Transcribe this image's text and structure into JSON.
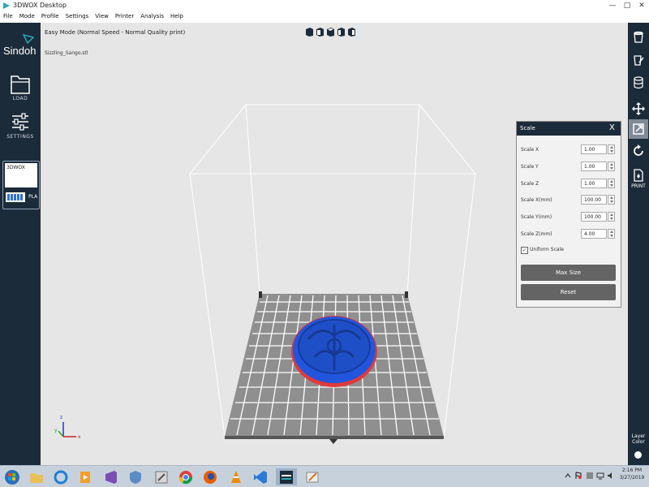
{
  "window": {
    "title": "3DWOX Desktop",
    "minimize": "—",
    "maximize": "□",
    "close": "✕"
  },
  "menu": [
    "File",
    "Mode",
    "Profile",
    "Settings",
    "View",
    "Printer",
    "Analysis",
    "Help"
  ],
  "brand": {
    "logo_text": "Sindoh",
    "accent": "#2aa7b8"
  },
  "sidebar": {
    "load_label": "LOAD",
    "settings_label": "SETTINGS",
    "material": {
      "name": "3DWOX",
      "type": "PLA",
      "bar_color": "#2f72d6"
    }
  },
  "viewport": {
    "mode_text": "Easy Mode (Normal Speed - Normal Quality print)",
    "file_name": "Sizzling_Sango.stl",
    "model_color": "#2255dd",
    "model_outline": "#e03a3a",
    "axes": {
      "z": "z",
      "y": "y",
      "x": "x"
    }
  },
  "scale_panel": {
    "title": "Scale",
    "close": "X",
    "rows": [
      {
        "label": "Scale X",
        "value": "1.00"
      },
      {
        "label": "Scale Y",
        "value": "1.00"
      },
      {
        "label": "Scale Z",
        "value": "1.00"
      },
      {
        "label": "Scale X(mm)",
        "value": "100.00"
      },
      {
        "label": "Scale Y(mm)",
        "value": "100.00"
      },
      {
        "label": "Scale Z(mm)",
        "value": "4.00"
      }
    ],
    "uniform_checked": "✓",
    "uniform_label": "Uniform Scale",
    "max_size_label": "Max Size",
    "reset_label": "Reset"
  },
  "rightbar": {
    "print_label": "PRINT",
    "layer_color_label_1": "Layer",
    "layer_color_label_2": "Color"
  },
  "taskbar": {
    "time": "2:16 PM",
    "date": "3/27/2019"
  }
}
